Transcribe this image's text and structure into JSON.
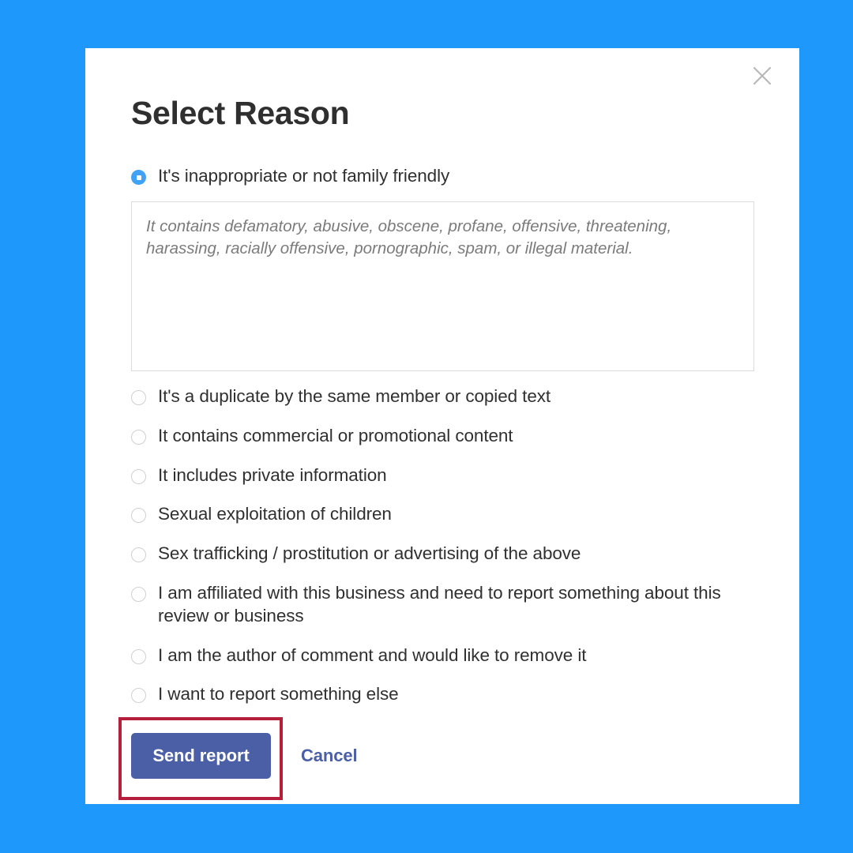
{
  "theme": {
    "background_color": "#1e99fb",
    "dialog_background": "#ffffff",
    "accent_blue": "#3fa2f7",
    "button_color": "#4a5fa5",
    "highlight_color": "#b51f3c",
    "title_color": "#2f2f2f"
  },
  "dialog": {
    "title": "Select Reason",
    "close_icon": "close-icon"
  },
  "selected_option_index": 0,
  "options": [
    {
      "label": "It's inappropriate or not family friendly",
      "selected": true
    },
    {
      "label": "It's a duplicate by the same member or copied text",
      "selected": false
    },
    {
      "label": "It contains commercial or promotional content",
      "selected": false
    },
    {
      "label": "It includes private information",
      "selected": false
    },
    {
      "label": "Sexual exploitation of children",
      "selected": false
    },
    {
      "label": "Sex trafficking / prostitution or advertising of the above",
      "selected": false
    },
    {
      "label": "I am affiliated with this business and need to report something about this review or business",
      "selected": false
    },
    {
      "label": "I am the author of comment and would like to remove it",
      "selected": false
    },
    {
      "label": "I want to report something else",
      "selected": false
    }
  ],
  "details_field": {
    "value": "",
    "placeholder": "It contains defamatory, abusive, obscene, profane, offensive, threatening, harassing, racially offensive, pornographic, spam, or illegal material."
  },
  "actions": {
    "submit_label": "Send report",
    "cancel_label": "Cancel"
  }
}
